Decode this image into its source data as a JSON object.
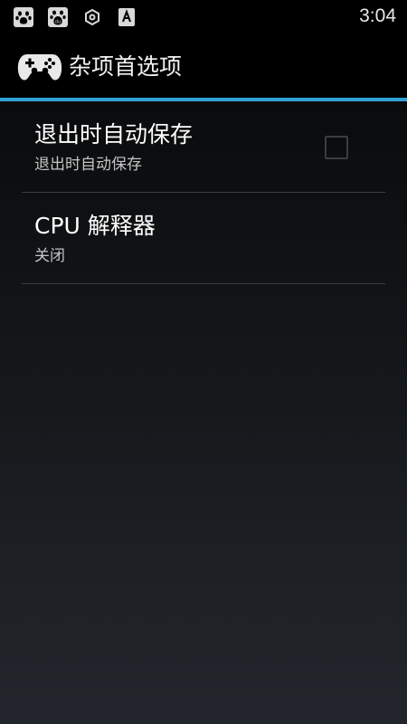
{
  "status_bar": {
    "time": "3:04",
    "icons": [
      "baidu-paw-icon",
      "baidu-paw-du-icon",
      "settings-cog-icon",
      "keyboard-a-icon"
    ]
  },
  "action_bar": {
    "logo_icon": "gamepad-icon",
    "title": "杂项首选项"
  },
  "preferences": [
    {
      "title": "退出时自动保存",
      "summary": "退出时自动保存",
      "checked": false
    },
    {
      "title": "CPU 解释器",
      "summary": "关闭"
    }
  ],
  "colors": {
    "accent": "#2fa3d7",
    "background_top": "#050607",
    "background_bottom": "#23272d"
  }
}
